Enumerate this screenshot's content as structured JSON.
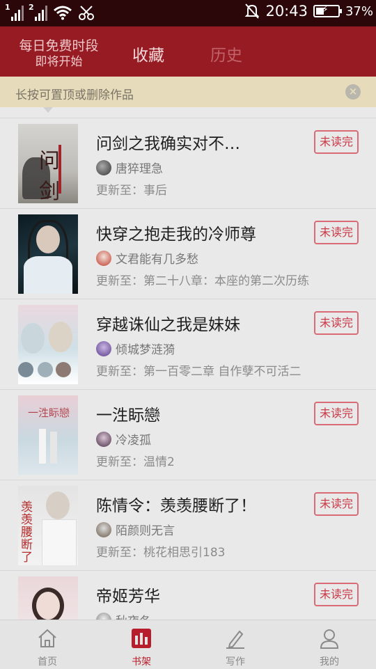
{
  "status_bar": {
    "sim1": "1",
    "sim2": "2",
    "time": "20:43",
    "battery_percent": "37%",
    "battery_level": 0.37
  },
  "header": {
    "free_slot_line1": "每日免费时段",
    "free_slot_line2": "即将开始",
    "tab_favorites": "收藏",
    "tab_history": "历史"
  },
  "tip": {
    "text": "长按可置顶或删除作品",
    "close_glyph": "×"
  },
  "books": [
    {
      "title": "问剑之我确实对不…",
      "author": "唐猝理急",
      "update": "更新至：事后",
      "badge": "未读完"
    },
    {
      "title": "快穿之抱走我的冷师尊",
      "author": "文君能有几多愁",
      "update": "更新至：第二十八章：本座的第二次历练",
      "badge": "未读完"
    },
    {
      "title": "穿越诛仙之我是妹妹",
      "author": "倾城梦涟漪",
      "update": "更新至：第一百零二章 自作孽不可活二",
      "badge": "未读完"
    },
    {
      "title": "一泩眎戀",
      "author": "冷凌孤",
      "update": "更新至：温情2",
      "badge": "未读完"
    },
    {
      "title": "陈情令：羡羡腰断了！",
      "author": "陌颜则无言",
      "update": "更新至：桃花相思引183",
      "badge": "未读完"
    },
    {
      "title": "帝姬芳华",
      "author": "秋夜冬",
      "update": "",
      "badge": "未读完"
    }
  ],
  "covers": [
    {
      "text": "问剑"
    },
    {
      "text": ""
    },
    {
      "text": ""
    },
    {
      "text": "一泩眎戀"
    },
    {
      "text": "羡羡腰断了"
    },
    {
      "text": ""
    }
  ],
  "bottom_nav": [
    {
      "label": "首页",
      "icon": "home-icon"
    },
    {
      "label": "书架",
      "icon": "bookshelf-icon"
    },
    {
      "label": "写作",
      "icon": "pen-icon"
    },
    {
      "label": "我的",
      "icon": "user-icon"
    }
  ],
  "colors": {
    "header": "#961b23",
    "status_bar": "#2b070a",
    "badge_border": "#d96b76",
    "active_nav": "#b71d2a"
  }
}
